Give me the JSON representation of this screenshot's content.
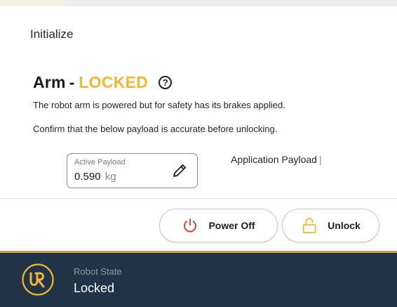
{
  "init": {
    "label": "Initialize"
  },
  "arm": {
    "title": "Arm",
    "dash": "-",
    "state": "LOCKED",
    "help_glyph": "?",
    "description": "The robot arm is powered but for safety has its brakes applied.",
    "confirm": "Confirm that the below payload is accurate before unlocking."
  },
  "payload": {
    "caption": "Active Payload",
    "value": "0.590",
    "unit": "kg",
    "edit_icon": "pencil-icon",
    "application_label": "Application Payload",
    "application_caret": "|"
  },
  "actions": {
    "power_off_label": "Power Off",
    "power_icon": "power-icon",
    "unlock_label": "Unlock",
    "unlock_icon": "unlock-icon"
  },
  "robot_state": {
    "caption": "Robot State",
    "value": "Locked",
    "logo_text": "UR"
  },
  "colors": {
    "accent_gold": "#f2b632",
    "status_bar": "#1f3446",
    "power_red": "#e0413a"
  }
}
